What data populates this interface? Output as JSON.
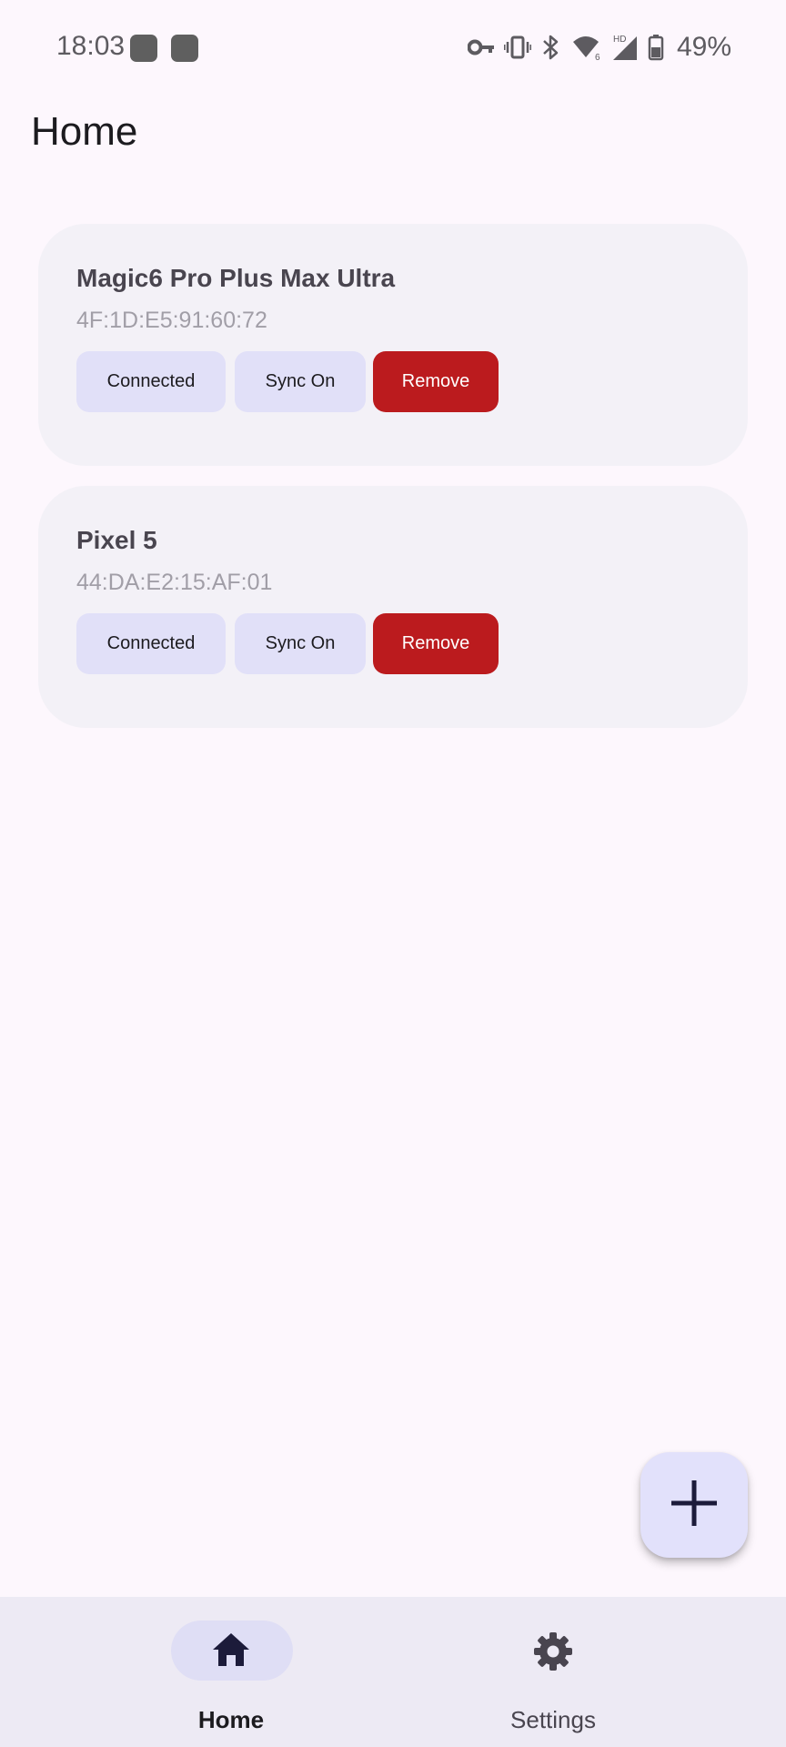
{
  "status_bar": {
    "time": "18:03",
    "battery": "49%",
    "icons": [
      "notification-square-icon",
      "notification-square-icon",
      "vpn-key-icon",
      "vibrate-icon",
      "bluetooth-icon",
      "wifi-icon",
      "signal-icon",
      "battery-icon"
    ],
    "network_badge": "HD",
    "wifi_badge": "6"
  },
  "header": {
    "title": "Home"
  },
  "devices": [
    {
      "name": "Magic6 Pro Plus Max Ultra",
      "mac": "4F:1D:E5:91:60:72",
      "connected_label": "Connected",
      "sync_label": "Sync On",
      "remove_label": "Remove"
    },
    {
      "name": "Pixel 5",
      "mac": "44:DA:E2:15:AF:01",
      "connected_label": "Connected",
      "sync_label": "Sync On",
      "remove_label": "Remove"
    }
  ],
  "fab": {
    "icon": "add-icon"
  },
  "bottom_nav": {
    "items": [
      {
        "label": "Home",
        "icon": "home-icon",
        "active": true
      },
      {
        "label": "Settings",
        "icon": "gear-icon",
        "active": false
      }
    ]
  },
  "colors": {
    "background": "#fdf7fd",
    "card": "#f3f1f7",
    "tonal_button": "#e1e0f8",
    "remove_button": "#bb1b1e",
    "nav_bar": "#edeaf4",
    "fab": "#e2e1fb"
  }
}
